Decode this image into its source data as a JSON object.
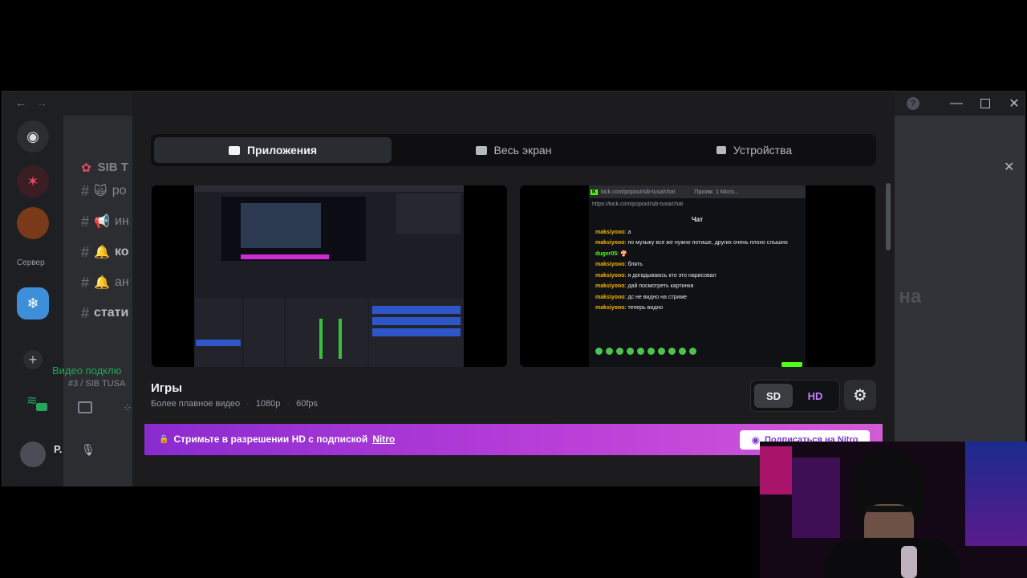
{
  "app": {
    "server_label": "Сервер",
    "server_name": "SIB T",
    "channels": [
      {
        "icon": "#",
        "emoji": "🙀",
        "label": "ро"
      },
      {
        "icon": "#",
        "emoji": "📢",
        "label": "ин"
      },
      {
        "icon": "#",
        "emoji": "🔔",
        "label": "ко"
      },
      {
        "icon": "#",
        "emoji": "🔔",
        "label": "ан"
      },
      {
        "icon": "#",
        "emoji": "",
        "label": "стати"
      }
    ],
    "voice_status": "Видео подклю",
    "voice_channel": "#3 / SIB TUSA",
    "username_initial": "Р.",
    "background_heading_fragment": "ь на"
  },
  "tabs": [
    {
      "label": "Приложения",
      "icon": "window-icon",
      "active": true
    },
    {
      "label": "Весь экран",
      "icon": "monitor-icon",
      "active": false
    },
    {
      "label": "Устройства",
      "icon": "camera-icon",
      "active": false
    }
  ],
  "thumbnail_right": {
    "url": "kick.com/popout/sib-tusa/chat",
    "window_title": "Призвк. 1 Micro...",
    "address": "https://kick.com/popout/sib-tusa/chat",
    "chat_header": "Чат",
    "messages": [
      {
        "user": "maksiyooo",
        "text": "a"
      },
      {
        "user": "maksiyooo",
        "text": "по музыку все же нужно потише, других очень плохо слышно"
      },
      {
        "user": "duger05",
        "text": "🍄"
      },
      {
        "user": "maksiyooo",
        "text": "блять"
      },
      {
        "user": "maksiyooo",
        "text": "я догадываюсь кто это нарисовал"
      },
      {
        "user": "maksiyooo",
        "text": "дай посмотреть картинки"
      },
      {
        "user": "maksiyooo",
        "text": "дс не видно на стриме"
      },
      {
        "user": "maksiyooo",
        "text": "теперь видно"
      }
    ]
  },
  "selection": {
    "title": "Игры",
    "details": [
      "Более плавное видео",
      "1080p",
      "60fps"
    ]
  },
  "quality": {
    "sd": "SD",
    "hd": "HD"
  },
  "nitro": {
    "text": "Стримьте в разрешении HD с подпиской",
    "link": "Nitro",
    "button": "Подписаться на Nitro"
  },
  "colors": {
    "nitro_start": "#8a2bd0",
    "nitro_end": "#d35bd7",
    "hd_accent": "#c77dff",
    "modal_bg": "#1c1c1f"
  }
}
